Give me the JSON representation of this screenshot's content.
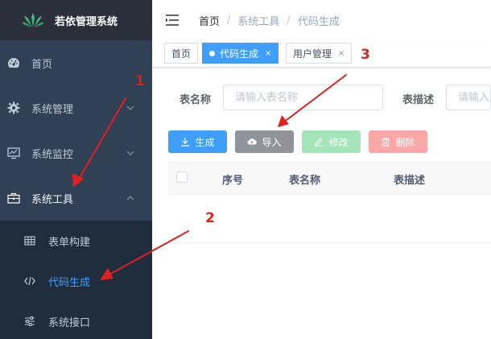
{
  "app": {
    "title": "若依管理系统"
  },
  "sidebar": {
    "items": [
      {
        "label": "首页",
        "icon": "dashboard-icon"
      },
      {
        "label": "系统管理",
        "icon": "gear-icon"
      },
      {
        "label": "系统监控",
        "icon": "monitor-icon"
      },
      {
        "label": "系统工具",
        "icon": "toolbox-icon"
      }
    ],
    "sub_items": [
      {
        "label": "表单构建",
        "icon": "form-grid-icon"
      },
      {
        "label": "代码生成",
        "icon": "code-icon"
      },
      {
        "label": "系统接口",
        "icon": "sliders-icon"
      }
    ]
  },
  "breadcrumb": {
    "home": "首页",
    "section": "系统工具",
    "page": "代码生成",
    "separator": "/"
  },
  "tags": [
    {
      "label": "首页"
    },
    {
      "label": "代码生成",
      "close": "×"
    },
    {
      "label": "用户管理",
      "close": "×"
    }
  ],
  "search": {
    "table_name_label": "表名称",
    "table_name_placeholder": "请输入表名称",
    "table_desc_label": "表描述",
    "table_desc_placeholder": "请输入"
  },
  "toolbar": {
    "generate": "生成",
    "import": "导入",
    "edit": "修改",
    "delete": "删除"
  },
  "table": {
    "headers": [
      "序号",
      "表名称",
      "表描述"
    ]
  },
  "annotations": {
    "one": "1",
    "two": "2",
    "three": "3"
  },
  "colors": {
    "sidebar": "#304156",
    "accent": "#409eff",
    "annotation": "#e02020"
  }
}
